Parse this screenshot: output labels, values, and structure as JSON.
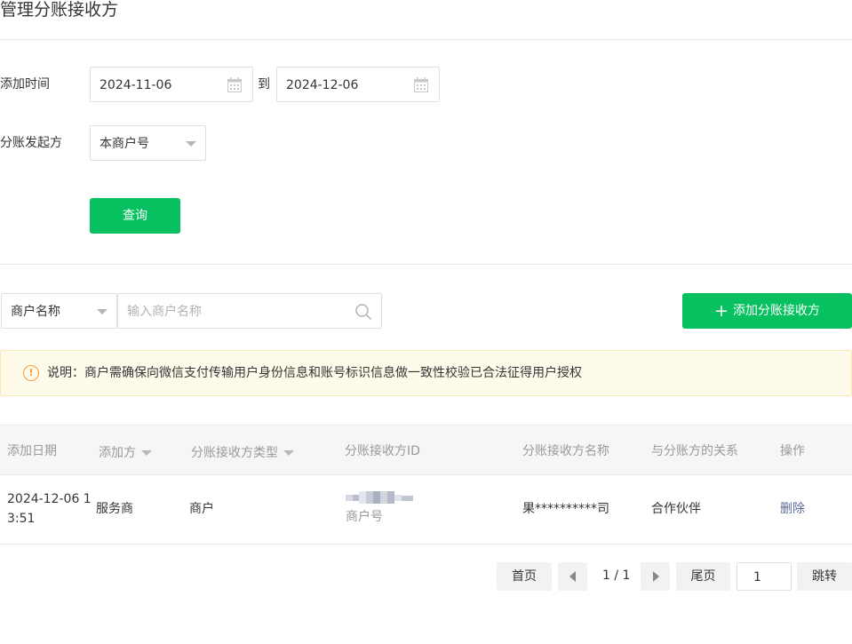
{
  "page": {
    "title": "管理分账接收方"
  },
  "filters": {
    "date_label": "添加时间",
    "start_date": "2024-11-06",
    "date_separator": "到",
    "end_date": "2024-12-06",
    "initiator_label": "分账发起方",
    "initiator_value": "本商户号",
    "query_button": "查询"
  },
  "search": {
    "field_select": "商户名称",
    "placeholder": "输入商户名称",
    "add_button": "添加分账接收方"
  },
  "notice": {
    "icon": "warning-circle-icon",
    "text": "说明：商户需确保向微信支付传输用户身份信息和账号标识信息做一致性校验已合法征得用户授权",
    "color": "#fa9d3b"
  },
  "table": {
    "headers": [
      "添加日期",
      "添加方",
      "分账接收方类型",
      "分账接收方ID",
      "分账接收方名称",
      "与分账方的关系",
      "操作"
    ],
    "rows": [
      {
        "date_line1": "2024-12-06 1",
        "date_line2": "3:51",
        "added_by": "服务商",
        "receiver_type": "商户",
        "receiver_id_type": "商户号",
        "receiver_name": "果**********司",
        "relation": "合作伙伴",
        "action": "删除"
      }
    ]
  },
  "pagination": {
    "first": "首页",
    "info": "1 / 1",
    "last": "尾页",
    "page_input": "1",
    "jump": "跳转"
  },
  "colors": {
    "accent": "#07c160",
    "link": "#576b95",
    "notice_bg": "#fffbeb"
  }
}
